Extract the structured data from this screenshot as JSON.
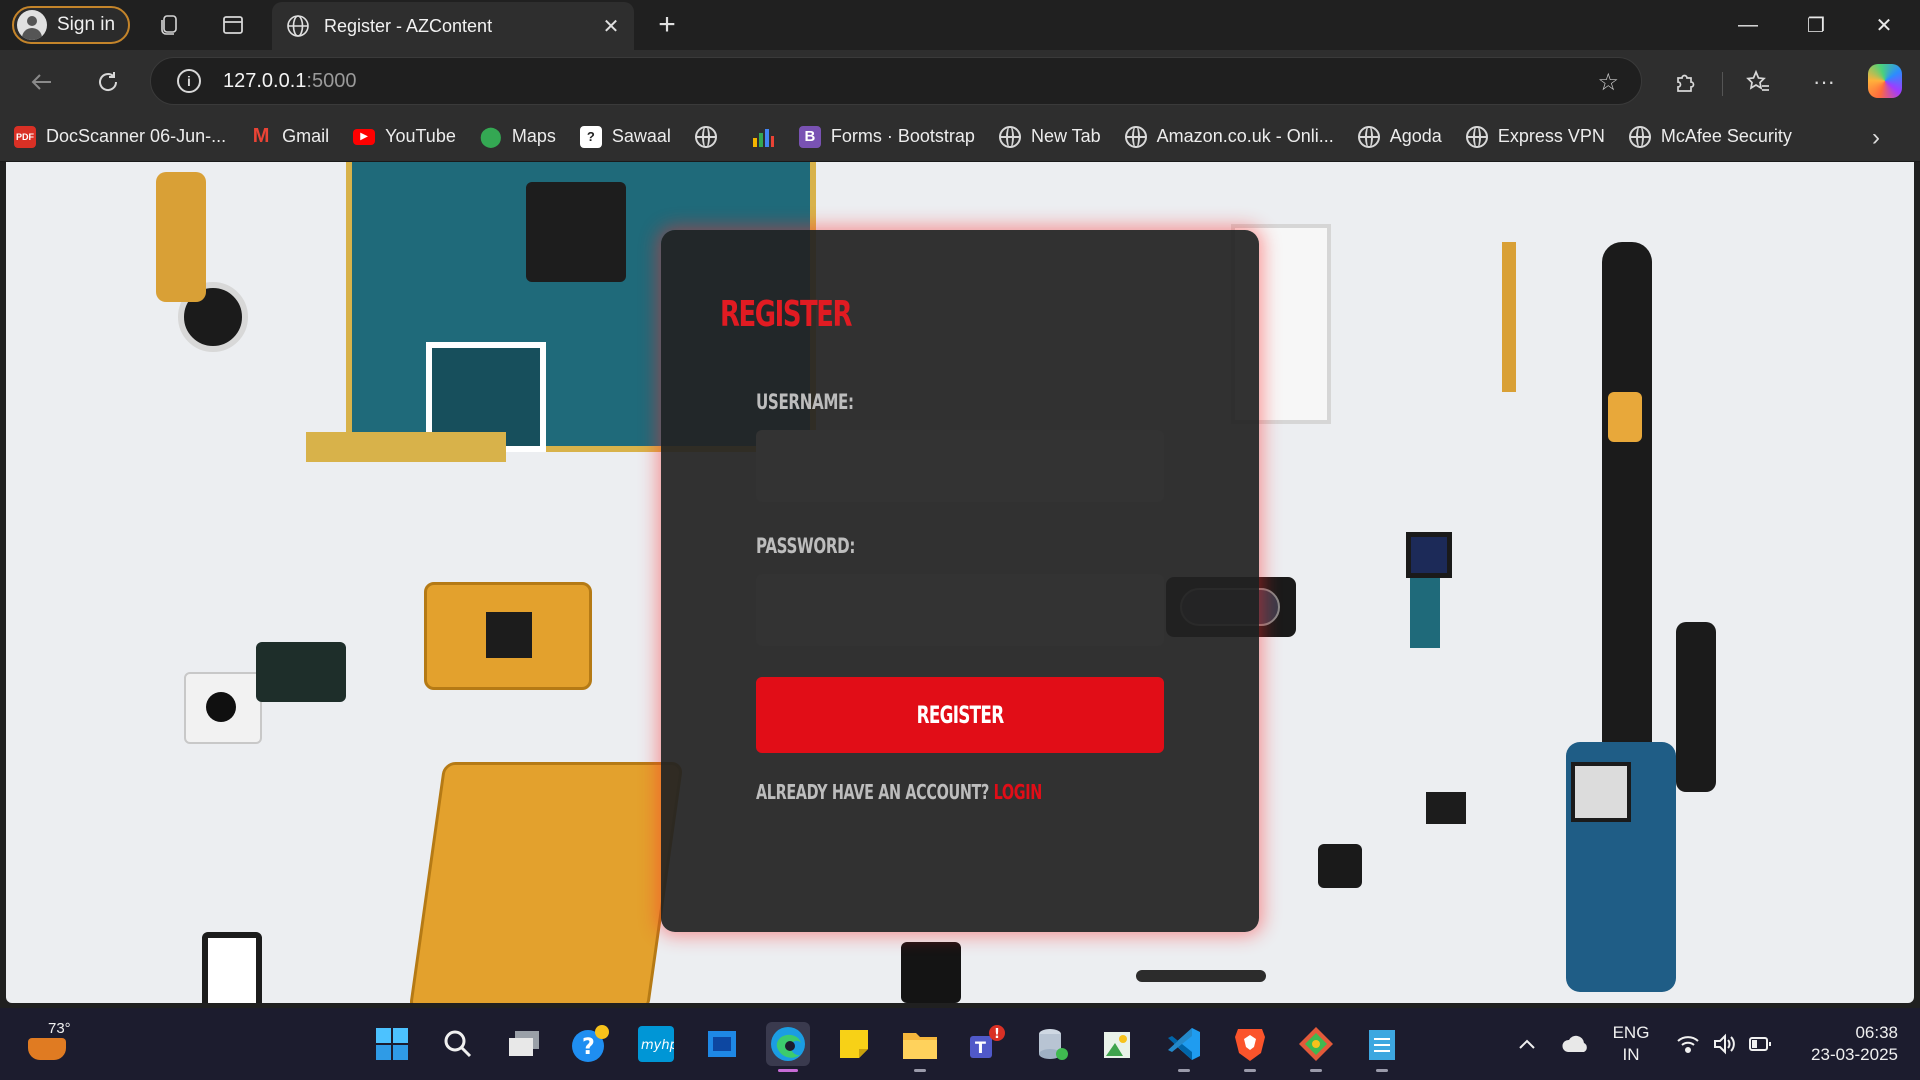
{
  "browser": {
    "sign_in_label": "Sign in",
    "tab_title": "Register - AZContent",
    "tab_close": "✕",
    "new_tab": "+",
    "url_host": "127.0.0.1",
    "url_port": ":5000",
    "window": {
      "minimize": "—",
      "restore": "❐",
      "close": "✕"
    },
    "icons": {
      "back": "arrow-left-icon",
      "refresh": "refresh-icon",
      "favorite": "star-icon",
      "extensions": "puzzle-icon",
      "favorites": "favorites-icon",
      "more": "ellipsis-icon",
      "copilot": "copilot-icon"
    }
  },
  "bookmarks": [
    {
      "label": "DocScanner 06-Jun-...",
      "icon": "pdf-icon",
      "color": "#d93025"
    },
    {
      "label": "Gmail",
      "icon": "gmail-icon",
      "color": "#ea4335"
    },
    {
      "label": "YouTube",
      "icon": "youtube-icon",
      "color": "#ff0000"
    },
    {
      "label": "Maps",
      "icon": "maps-pin-icon",
      "color": "#34a853"
    },
    {
      "label": "Sawaal",
      "icon": "sawaal-icon",
      "color": "#ffffff"
    },
    {
      "label": "",
      "icon": "globe-icon",
      "color": "#d8d8d8"
    },
    {
      "label": "",
      "icon": "bar-chart-icon",
      "color": "#f4b400"
    },
    {
      "label": "Forms · Bootstrap",
      "icon": "bootstrap-icon",
      "color": "#7952b3"
    },
    {
      "label": "New Tab",
      "icon": "globe-icon",
      "color": "#d8d8d8"
    },
    {
      "label": "Amazon.co.uk - Onli...",
      "icon": "globe-icon",
      "color": "#d8d8d8"
    },
    {
      "label": "Agoda",
      "icon": "globe-icon",
      "color": "#d8d8d8"
    },
    {
      "label": "Express VPN",
      "icon": "globe-icon",
      "color": "#d8d8d8"
    },
    {
      "label": "McAfee Security",
      "icon": "globe-icon",
      "color": "#d8d8d8"
    }
  ],
  "form": {
    "title": "REGISTER",
    "username_label": "USERNAME:",
    "username_value": "",
    "password_label": "PASSWORD:",
    "password_value": "",
    "submit_label": "REGISTER",
    "login_prompt": "ALREADY HAVE AN ACCOUNT?",
    "login_link": "LOGIN",
    "accent_color": "#e10d17"
  },
  "taskbar": {
    "weather_temp": "73°",
    "language_line1": "ENG",
    "language_line2": "IN",
    "time": "06:38",
    "date": "23-03-2025",
    "apps": [
      "windows-start-icon",
      "search-icon",
      "task-view-icon",
      "help-icon",
      "myhp-icon",
      "store-icon",
      "edge-icon",
      "sticky-notes-icon",
      "file-explorer-icon",
      "teams-icon",
      "db-app-icon",
      "image-app-icon",
      "vscode-icon",
      "brave-icon",
      "git-icon",
      "notepad-icon"
    ],
    "teams_badge": "!"
  }
}
